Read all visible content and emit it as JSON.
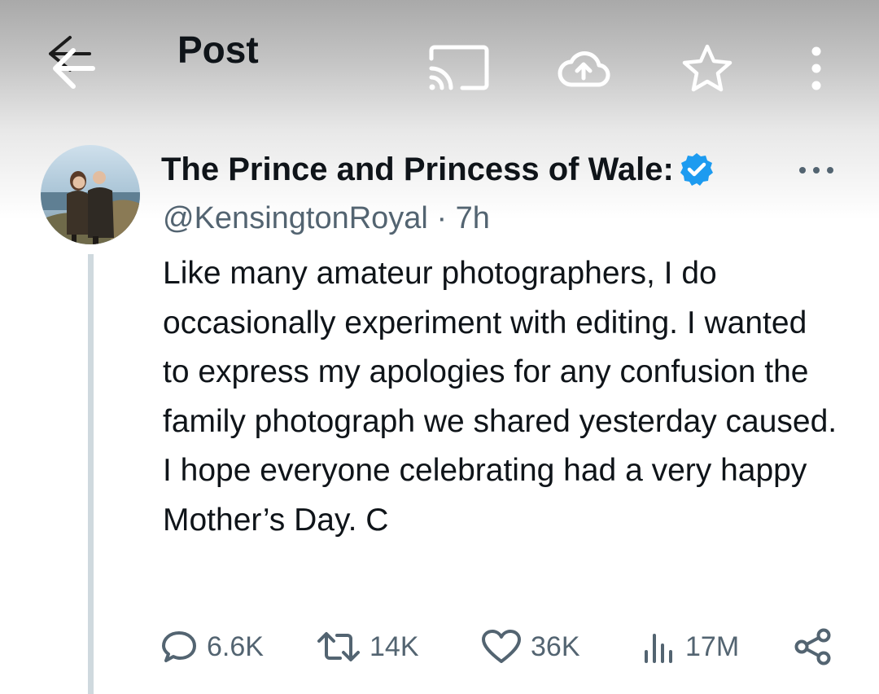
{
  "header": {
    "title": "Post",
    "icons": [
      "back-arrow-icon",
      "cast-icon",
      "cloud-upload-icon",
      "star-icon",
      "more-vertical-icon"
    ]
  },
  "post": {
    "author": "The Prince and Princess of Wale:",
    "handle": "@KensingtonRoyal",
    "separator": "·",
    "time": "7h",
    "text": "Like many amateur photographers, I do occasionally experiment with editing. I wanted to express my apologies for any confusion the family photograph we shared yesterday caused. I hope everyone celebrating had a very happy Mother’s Day. C",
    "verified_color": "#1d9bf0"
  },
  "actions": {
    "replies": "6.6K",
    "reposts": "14K",
    "likes": "36K",
    "views": "17M"
  },
  "colors": {
    "text": "#0f1419",
    "secondary": "#536471",
    "thread_line": "#cfd9de",
    "accent": "#1d9bf0"
  }
}
